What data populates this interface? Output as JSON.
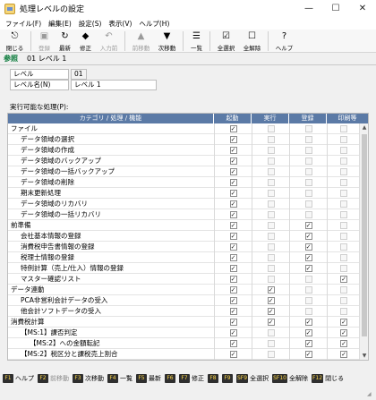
{
  "window": {
    "title": "処理レベルの設定",
    "minimize": "—",
    "maximize": "☐",
    "close": "✕"
  },
  "menu": [
    "ファイル(F)",
    "編集(E)",
    "設定(S)",
    "表示(V)",
    "ヘルプ(H)"
  ],
  "toolbar": [
    {
      "label": "閉じる",
      "icon": "close-door-icon",
      "glyph": "⎋",
      "enabled": true
    },
    {
      "label": "登録",
      "icon": "register-icon",
      "glyph": "▣",
      "enabled": false
    },
    {
      "label": "最新",
      "icon": "refresh-icon",
      "glyph": "↻",
      "enabled": true
    },
    {
      "label": "修正",
      "icon": "edit-icon",
      "glyph": "◆",
      "enabled": true
    },
    {
      "label": "入力前",
      "icon": "undo-input-icon",
      "glyph": "↶",
      "enabled": false
    },
    {
      "label": "前移動",
      "icon": "previous-icon",
      "glyph": "▲",
      "enabled": false
    },
    {
      "label": "次移動",
      "icon": "next-icon",
      "glyph": "▼",
      "enabled": true
    },
    {
      "label": "一覧",
      "icon": "list-icon",
      "glyph": "☰",
      "enabled": true
    },
    {
      "label": "全選択",
      "icon": "select-all-icon",
      "glyph": "☑",
      "enabled": true
    },
    {
      "label": "全解除",
      "icon": "deselect-all-icon",
      "glyph": "☐",
      "enabled": true
    },
    {
      "label": "ヘルプ",
      "icon": "help-icon",
      "glyph": "?",
      "enabled": true
    }
  ],
  "reference": {
    "tag": "参照",
    "value": "01 レベル 1"
  },
  "fields": {
    "level_label": "レベル",
    "level_value": "01",
    "name_label": "レベル名(N)",
    "name_value": "レベル 1"
  },
  "list_caption": "実行可能な処理(P):",
  "grid": {
    "headers": [
      "カテゴリ / 処理 / 機能",
      "起動",
      "実行",
      "登録",
      "印刷等"
    ],
    "rows": [
      {
        "label": "ファイル",
        "indent": 0,
        "checks": [
          "on",
          "dis",
          "dis",
          "dis"
        ]
      },
      {
        "label": "データ領域の選択",
        "indent": 1,
        "checks": [
          "on",
          "dis",
          "dis",
          "dis"
        ]
      },
      {
        "label": "データ領域の作成",
        "indent": 1,
        "checks": [
          "on",
          "dis",
          "dis",
          "dis"
        ]
      },
      {
        "label": "データ領域のバックアップ",
        "indent": 1,
        "checks": [
          "on",
          "dis",
          "dis",
          "dis"
        ]
      },
      {
        "label": "データ領域の一括バックアップ",
        "indent": 1,
        "checks": [
          "on",
          "dis",
          "dis",
          "dis"
        ]
      },
      {
        "label": "データ領域の削除",
        "indent": 1,
        "checks": [
          "on",
          "dis",
          "dis",
          "dis"
        ]
      },
      {
        "label": "期末更新処理",
        "indent": 1,
        "checks": [
          "on",
          "dis",
          "dis",
          "dis"
        ]
      },
      {
        "label": "データ領域のリカバリ",
        "indent": 1,
        "checks": [
          "on",
          "dis",
          "dis",
          "dis"
        ]
      },
      {
        "label": "データ領域の一括リカバリ",
        "indent": 1,
        "checks": [
          "on",
          "dis",
          "dis",
          "dis"
        ]
      },
      {
        "label": "前準備",
        "indent": 0,
        "checks": [
          "on",
          "dis",
          "on",
          "dis"
        ]
      },
      {
        "label": "会社基本情報の登録",
        "indent": 1,
        "checks": [
          "on",
          "dis",
          "on",
          "dis"
        ]
      },
      {
        "label": "消費税申告書情報の登録",
        "indent": 1,
        "checks": [
          "on",
          "dis",
          "on",
          "dis"
        ]
      },
      {
        "label": "税理士情報の登録",
        "indent": 1,
        "checks": [
          "on",
          "dis",
          "on",
          "dis"
        ]
      },
      {
        "label": "特例計算（売上/仕入）情報の登録",
        "indent": 1,
        "checks": [
          "on",
          "dis",
          "on",
          "dis"
        ]
      },
      {
        "label": "マスター確認リスト",
        "indent": 1,
        "checks": [
          "on",
          "dis",
          "dis",
          "on"
        ]
      },
      {
        "label": "データ連動",
        "indent": 0,
        "checks": [
          "on",
          "on",
          "dis",
          "dis"
        ]
      },
      {
        "label": "PCA非営利会計データの受入",
        "indent": 1,
        "checks": [
          "on",
          "on",
          "dis",
          "dis"
        ]
      },
      {
        "label": "他会計ソフトデータの受入",
        "indent": 1,
        "checks": [
          "on",
          "on",
          "dis",
          "dis"
        ]
      },
      {
        "label": "消費税計算",
        "indent": 0,
        "checks": [
          "on",
          "on",
          "on",
          "on"
        ]
      },
      {
        "label": "【MS:1】課否判定",
        "indent": 1,
        "checks": [
          "on",
          "dis",
          "on",
          "on"
        ]
      },
      {
        "label": "【MS:2】への金額転記",
        "indent": 2,
        "checks": [
          "on",
          "dis",
          "on",
          "on"
        ]
      },
      {
        "label": "【MS:2】税区分と課税売上割合",
        "indent": 1,
        "checks": [
          "on",
          "dis",
          "on",
          "on"
        ]
      }
    ]
  },
  "fkeys": [
    {
      "key": "F1",
      "label": "ヘルプ",
      "enabled": true
    },
    {
      "key": "F2",
      "label": "前移動",
      "enabled": false
    },
    {
      "key": "F3",
      "label": "次移動",
      "enabled": true
    },
    {
      "key": "F4",
      "label": "一覧",
      "enabled": true
    },
    {
      "key": "F5",
      "label": "最新",
      "enabled": true
    },
    {
      "key": "F6",
      "label": "",
      "enabled": false
    },
    {
      "key": "F7",
      "label": "修正",
      "enabled": true
    },
    {
      "key": "F8",
      "label": "",
      "enabled": false
    },
    {
      "key": "F9",
      "label": "",
      "enabled": false
    },
    {
      "key": "SF9",
      "label": "全選択",
      "enabled": true
    },
    {
      "key": "SF10",
      "label": "全解除",
      "enabled": true
    },
    {
      "key": "F12",
      "label": "閉じる",
      "enabled": true
    }
  ],
  "colors": {
    "header_bg": "#5b7aa6",
    "reference_tag": "#0a7a3a",
    "fkey_text": "#ffd84a"
  }
}
